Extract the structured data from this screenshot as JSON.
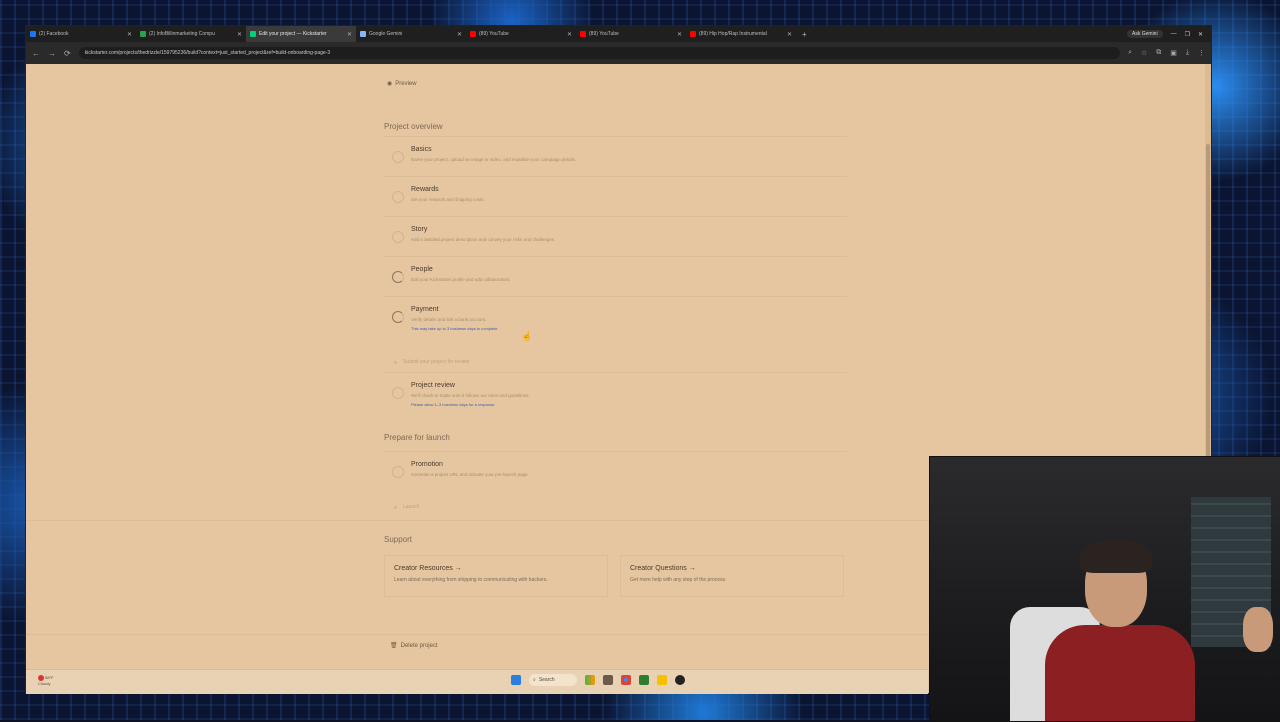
{
  "browser": {
    "tabs": [
      {
        "title": "(2) Facebook",
        "color": "#1877f2",
        "active": false
      },
      {
        "title": "(2) InfoBillinmarketing Compu",
        "color": "#2e9e4f",
        "active": false
      },
      {
        "title": "Edit your project — Kickstarter",
        "color": "#05ce78",
        "active": true
      },
      {
        "title": "Google Gemini",
        "color": "#8ab4f8",
        "active": false
      },
      {
        "title": "(89) YouTube",
        "color": "#ff0000",
        "active": false
      },
      {
        "title": "(89) YouTube",
        "color": "#ff0000",
        "active": false
      },
      {
        "title": "(89) Hip Hop/Rap Instrumental",
        "color": "#ff0000",
        "active": false
      }
    ],
    "ask_gemini": "Ask Gemini",
    "url": "kickstarter.com/projects/thedrizzle/159795236/build?context=just_started_project&ref=build-onboarding-page-3"
  },
  "page": {
    "preview_label": "Preview",
    "overview_title": "Project overview",
    "steps": [
      {
        "name": "Basics",
        "desc": "Name your project, upload an image or video, and establish your campaign details.",
        "note": ""
      },
      {
        "name": "Rewards",
        "desc": "Set your rewards and shipping costs.",
        "note": ""
      },
      {
        "name": "Story",
        "desc": "Add a detailed project description and convey your risks and challenges.",
        "note": ""
      },
      {
        "name": "People",
        "desc": "Edit your Kickstarter profile and add collaborators.",
        "note": ""
      },
      {
        "name": "Payment",
        "desc": "Verify details and link a bank account.",
        "note": "This may take up to 3 business days to complete"
      }
    ],
    "submit_line": "Submit your project for review",
    "review_step": {
      "name": "Project review",
      "desc": "We'll check to make sure it follows our rules and guidelines.",
      "note": "Please allow 1–3 business days for a response."
    },
    "launch_title": "Prepare for launch",
    "promotion_step": {
      "name": "Promotion",
      "desc": "Generate a project URL and activate your pre-launch page."
    },
    "launch_line": "Launch",
    "support_title": "Support",
    "support_cards": [
      {
        "title": "Creator Resources →",
        "desc": "Learn about everything from shipping to communicating with backers."
      },
      {
        "title": "Creator Questions →",
        "desc": "Get more help with any step of the process."
      }
    ],
    "delete_label": "Delete project"
  },
  "taskbar": {
    "weather_temp": "58°F",
    "weather_desc": "Cloudy",
    "search_label": "Search"
  }
}
